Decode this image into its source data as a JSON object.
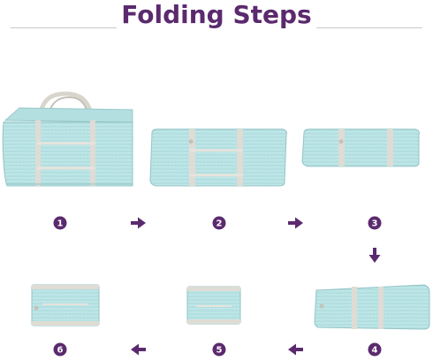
{
  "title": "Folding Steps",
  "colors": {
    "title": "#5b2a6e",
    "accent": "#5b2a6e",
    "bag_fill": "#bfe6e7",
    "bag_edge": "#9fcfd1",
    "strap": "#dedcd4"
  },
  "steps": [
    {
      "number": "1",
      "icon": "duffel-bag-open-icon"
    },
    {
      "number": "2",
      "icon": "bag-folded-handles-icon"
    },
    {
      "number": "3",
      "icon": "bag-flattened-icon"
    },
    {
      "number": "4",
      "icon": "bag-rolled-icon"
    },
    {
      "number": "5",
      "icon": "bag-folded-half-icon"
    },
    {
      "number": "6",
      "icon": "bag-folded-packet-icon"
    }
  ],
  "arrows": [
    "arrow-right-icon",
    "arrow-right-icon",
    "arrow-down-icon",
    "arrow-left-icon",
    "arrow-left-icon"
  ]
}
